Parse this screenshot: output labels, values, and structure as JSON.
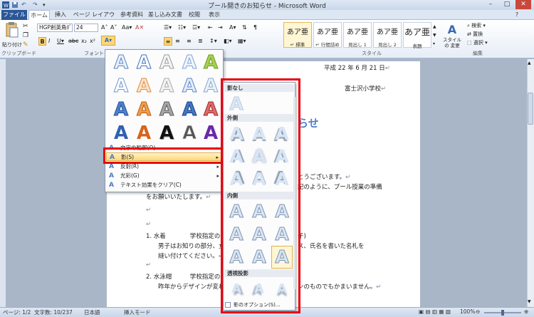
{
  "window": {
    "title": "プール開きのお知らせ - Microsoft Word",
    "controls": [
      "–",
      "□",
      "✕"
    ]
  },
  "tabs": [
    "ファイル",
    "ホーム",
    "挿入",
    "ページ レイアウト",
    "参考資料",
    "差し込み文書",
    "校閲",
    "表示"
  ],
  "ribbon": {
    "paste_label": "貼り付け",
    "clipboard_label": "クリップボード",
    "font_name": "HGP創英角ﾎﾟ",
    "font_size": "24",
    "font_label": "フォント",
    "styles_label": "スタイル",
    "styles": [
      {
        "sample": "あア亜",
        "name": "↵ 標準"
      },
      {
        "sample": "あア亜",
        "name": "↵ 行間詰め"
      },
      {
        "sample": "あア亜",
        "name": "見出し 1"
      },
      {
        "sample": "あア亜",
        "name": "見出し 2"
      },
      {
        "sample": "あア亜",
        "name": "表題"
      }
    ],
    "change_styles": "スタイルの 変更",
    "search": "検索",
    "replace": "置換",
    "select": "選択",
    "edit_label": "編集"
  },
  "effects_menu": {
    "items": [
      {
        "label": "文字の輪郭(O)"
      },
      {
        "label": "影(S)"
      },
      {
        "label": "反射(R)"
      },
      {
        "label": "光彩(G)"
      },
      {
        "label": "テキスト効果をクリア(C)"
      }
    ],
    "gallery_glyph": "A"
  },
  "shadow_menu": {
    "sections": [
      "影なし",
      "外側",
      "内側",
      "透視投影"
    ],
    "options": "影のオプション(S)...",
    "glyph": "A"
  },
  "document": {
    "date": "平成 22 年 6 月 21 日",
    "school": "富士沢小学校",
    "title_fragment": "らせ",
    "lines": [
      "とうございます。",
      "記のように、プール授業の準備",
      "をお願いいたします。",
      "1.  水着　　　　学校指定の",
      "子)",
      "男子はお知りの部分、女",
      "ス、氏名を書いた名札を",
      "縫い付けてください。",
      "2.  水泳帽　　　学校指定の",
      "昨年からデザインが変わ",
      "ンのものでもかまいません。"
    ]
  },
  "status": {
    "page": "ページ: 1/2",
    "chars": "文字数: 10/237",
    "lang": "日本語",
    "mode": "挿入モード",
    "zoom": "100%"
  },
  "colors": {
    "accent": "#2b5797",
    "highlight_border": "#e8000b",
    "menu_hover": "#ffd777"
  }
}
